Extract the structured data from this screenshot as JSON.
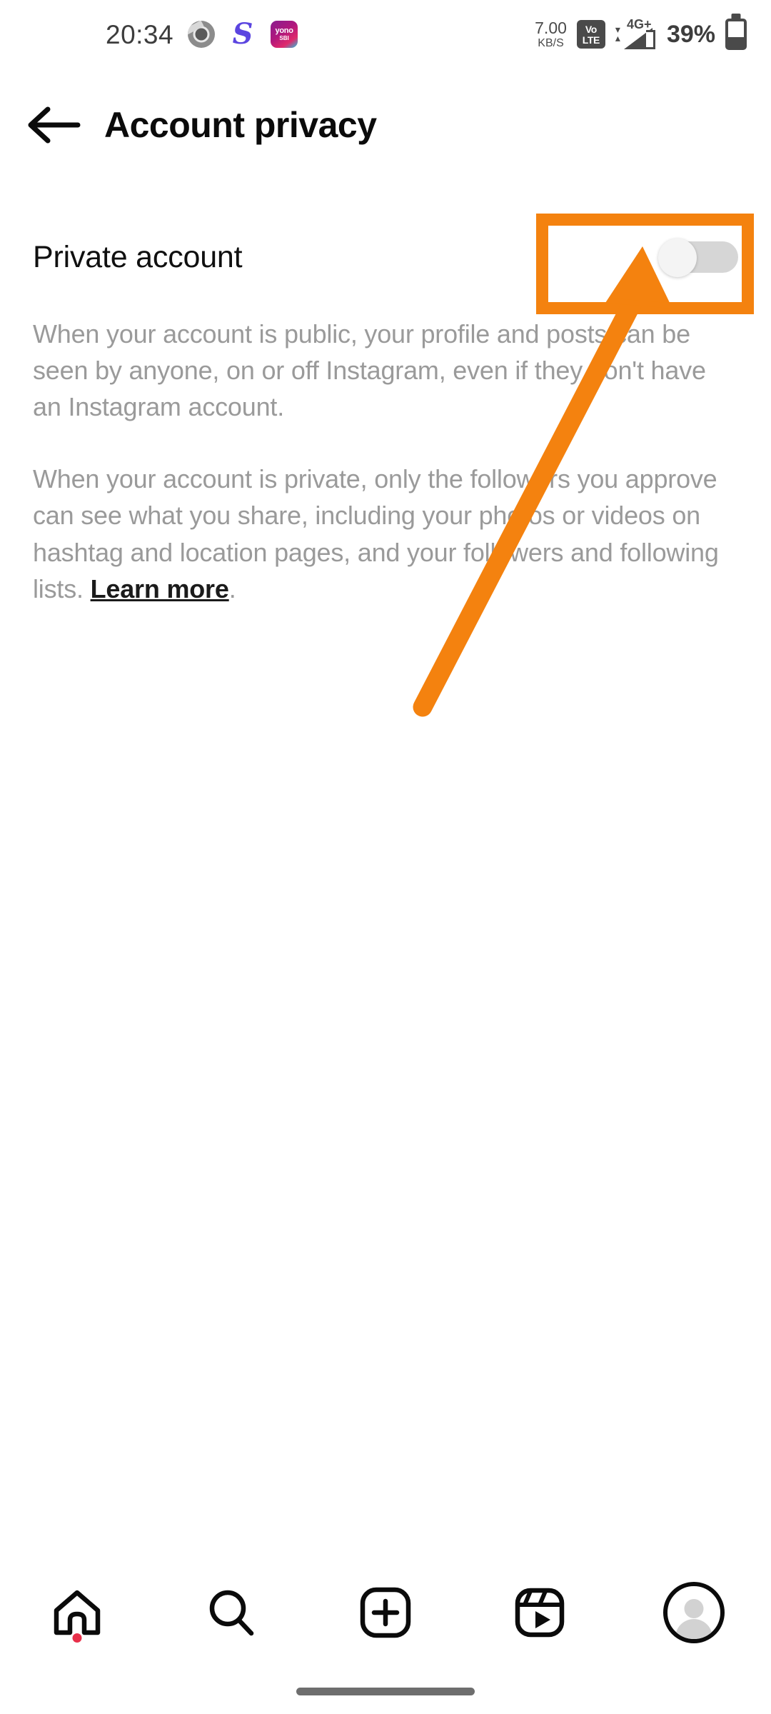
{
  "status_bar": {
    "time": "20:34",
    "app_icons": [
      {
        "name": "chrome-icon",
        "label": ""
      },
      {
        "name": "s-app-icon",
        "label": "S"
      },
      {
        "name": "yono-sbi-icon",
        "label_top": "yono",
        "label_bottom": "SBI"
      }
    ],
    "network_speed_value": "7.00",
    "network_speed_unit": "KB/S",
    "volte_top": "Vo",
    "volte_bottom": "LTE",
    "network_type": "4G+",
    "battery_percent": "39%"
  },
  "header": {
    "back_icon": "arrow-left-icon",
    "title": "Account privacy"
  },
  "main": {
    "setting_label": "Private account",
    "toggle": {
      "name": "private-account-toggle",
      "state": "off",
      "track_color": "#d6d6d6",
      "knob_color": "#f4f4f4"
    },
    "paragraph_1": "When your account is public, your profile and posts can be seen by anyone, on or off Instagram, even if they don't have an Instagram account.",
    "paragraph_2_before_link": "When your account is private, only the followers you approve can see what you share, including your photos or videos on hashtag and location pages, and your followers and following lists. ",
    "learn_more_label": "Learn more",
    "paragraph_2_after_link": "."
  },
  "annotation": {
    "color": "#F4820F",
    "highlight_box_target": "private-account-toggle",
    "arrow_points_to": "private-account-toggle"
  },
  "bottom_nav": {
    "items": [
      {
        "name": "nav-home",
        "icon": "home-icon",
        "has_badge": true,
        "badge_color": "#e8304a"
      },
      {
        "name": "nav-search",
        "icon": "search-icon",
        "has_badge": false
      },
      {
        "name": "nav-create",
        "icon": "plus-square-icon",
        "has_badge": false
      },
      {
        "name": "nav-reels",
        "icon": "reels-icon",
        "has_badge": false
      },
      {
        "name": "nav-profile",
        "icon": "avatar-icon",
        "has_badge": false
      }
    ]
  }
}
